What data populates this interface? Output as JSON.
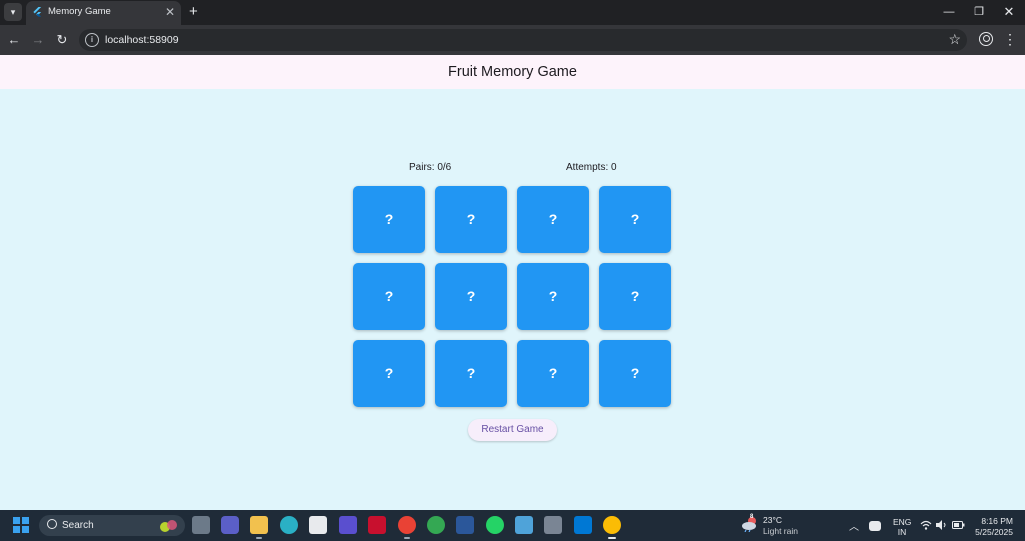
{
  "browser": {
    "tab_title": "Memory Game",
    "url": "localhost:58909",
    "new_tab_glyph": "+",
    "close_glyph": "✕"
  },
  "app": {
    "title": "Fruit Memory Game",
    "pairs_text": "Pairs: 0/6",
    "attempts_text": "Attempts: 0",
    "restart_label": "Restart Game",
    "card_colors": {
      "face_down": "#2196f3",
      "text": "#ffffff"
    },
    "cards": [
      {
        "label": "?"
      },
      {
        "label": "?"
      },
      {
        "label": "?"
      },
      {
        "label": "?"
      },
      {
        "label": "?"
      },
      {
        "label": "?"
      },
      {
        "label": "?"
      },
      {
        "label": "?"
      },
      {
        "label": "?"
      },
      {
        "label": "?"
      },
      {
        "label": "?"
      },
      {
        "label": "?"
      }
    ]
  },
  "taskbar": {
    "search_placeholder": "Search",
    "apps": [
      "task-view-icon",
      "teams-icon",
      "file-explorer-icon",
      "edge-icon",
      "store-icon",
      "app-icon",
      "mcafee-icon",
      "chrome-icon",
      "chrome-icon",
      "word-icon",
      "whatsapp-icon",
      "notepad-icon",
      "calculator-icon",
      "vscode-icon",
      "chrome-icon"
    ],
    "weather_temp": "23°C",
    "weather_desc": "Light rain",
    "weather_badge": "8",
    "lang_line1": "ENG",
    "lang_line2": "IN",
    "time": "8:16 PM",
    "date": "5/25/2025"
  }
}
